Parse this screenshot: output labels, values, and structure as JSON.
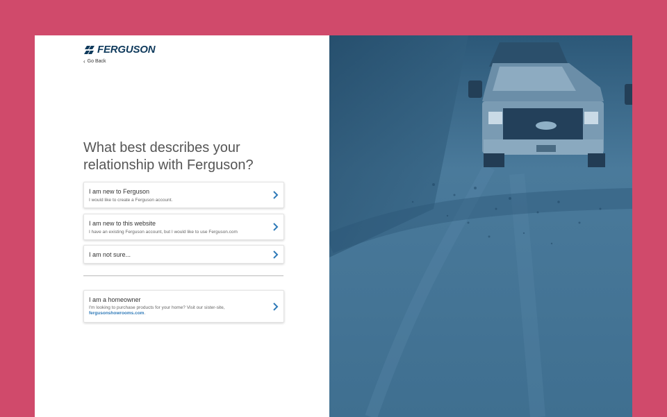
{
  "brand": {
    "name": "FERGUSON"
  },
  "nav": {
    "go_back": "Go Back"
  },
  "heading": "What best describes your relationship with Ferguson?",
  "options": [
    {
      "title": "I am new to Ferguson",
      "subtitle": "I would like to create a Ferguson account."
    },
    {
      "title": "I am new to this website",
      "subtitle": "I have an existing Ferguson account, but I would like to use Ferguson.com"
    },
    {
      "title": "I am not sure..."
    }
  ],
  "homeowner": {
    "title": "I am a homeowner",
    "subtitle": "I'm looking to purchase products for your home? Visit our sister-site,",
    "link": "fergusonshowrooms.com",
    "link_suffix": "."
  },
  "colors": {
    "background": "#d04a6b",
    "brand": "#0f3a5c",
    "accent": "#2f7ab8",
    "photo_tint": "#3b6b8d"
  },
  "icons": {
    "option_arrow": "chevron-right-icon",
    "back": "chevron-left-icon",
    "logo": "ferguson-logo-mark"
  }
}
